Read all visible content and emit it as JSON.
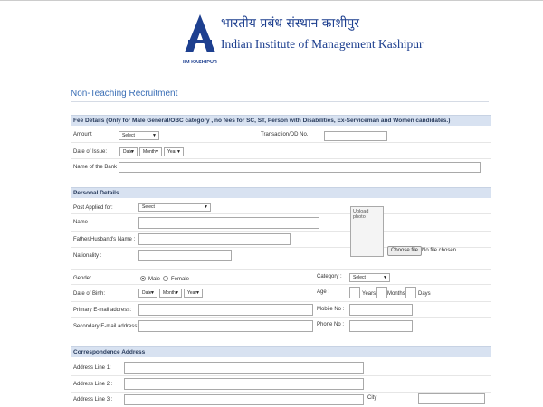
{
  "header": {
    "hindi_name": "भारतीय प्रबंध संस्थान काशीपुर",
    "english_name": "Indian Institute of Management Kashipur",
    "logo_caption": "IIM KASHIPUR",
    "brand_color": "#1d3f8f"
  },
  "page_title": "Non-Teaching Recruitment",
  "fee_section": {
    "heading": "Fee Details (Only for Male General/OBC category , no fees for SC, ST, Person with Disabilities, Ex-Serviceman and Women candidates.)",
    "amount_label": "Amount",
    "amount_value": "Select",
    "transaction_label": "Transaction/DD No.",
    "transaction_value": "",
    "date_label": "Date of Issue:",
    "date_day": "Date",
    "date_month": "Month",
    "date_year": "Year",
    "bank_label": "Name of the Bank",
    "bank_value": ""
  },
  "personal_section": {
    "heading": "Personal Details",
    "post_label": "Post Applied for:",
    "post_value": "Select",
    "name_label": "Name :",
    "father_label": "Father/Husband's Name :",
    "nationality_label": "Nationality :",
    "upload_label": "Upload photo",
    "choose_file": "Choose file",
    "no_file": "No file chosen",
    "gender_label": "Gender",
    "male": "Male",
    "female": "Female",
    "category_label": "Category :",
    "category_value": "Select",
    "dob_label": "Date of Birth:",
    "dob_day": "Date",
    "dob_month": "Month",
    "dob_year": "Year",
    "age_label": "Age :",
    "years": "Years",
    "months": "Months",
    "days": "Days",
    "primary_email_label": "Primary E-mail address:",
    "mobile_label": "Mobile No :",
    "secondary_email_label": "Secondary E-mail address:",
    "phone_label": "Phone No :"
  },
  "correspondence_section": {
    "heading": "Correspondence Address",
    "line1": "Address Line 1:",
    "line2": "Address Line 2 :",
    "line3": "Address Line 3 :",
    "city": "City"
  }
}
